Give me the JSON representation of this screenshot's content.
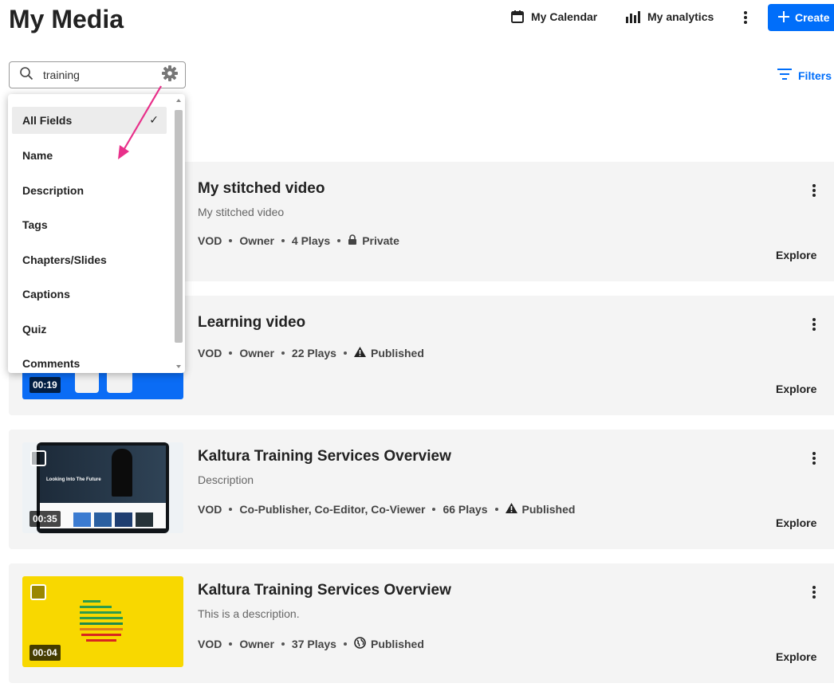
{
  "page": {
    "title": "My Media"
  },
  "header": {
    "calendar_label": "My Calendar",
    "analytics_label": "My analytics",
    "create_label": "Create"
  },
  "search": {
    "value": "training",
    "filters_label": "Filters"
  },
  "search_fields_menu": {
    "items": [
      "All Fields",
      "Name",
      "Description",
      "Tags",
      "Chapters/Slides",
      "Captions",
      "Quiz",
      "Comments"
    ],
    "selected": "All Fields",
    "check_glyph": "✓"
  },
  "media": [
    {
      "title": "My stitched video",
      "description": "My stitched video",
      "type": "VOD",
      "role": "Owner",
      "plays": "4 Plays",
      "status": "Private",
      "status_icon": "lock-icon",
      "duration": "",
      "explore": "Explore"
    },
    {
      "title": "Learning video",
      "description": "",
      "type": "VOD",
      "role": "Owner",
      "plays": "22 Plays",
      "status": "Published",
      "status_icon": "warning-icon",
      "duration": "00:19",
      "explore": "Explore"
    },
    {
      "title": "Kaltura Training Services Overview",
      "description": "Description",
      "type": "VOD",
      "role": "Co-Publisher, Co-Editor, Co-Viewer",
      "plays": "66 Plays",
      "status": "Published",
      "status_icon": "warning-icon",
      "duration": "00:35",
      "explore": "Explore"
    },
    {
      "title": "Kaltura Training Services Overview",
      "description": "This is a description.",
      "type": "VOD",
      "role": "Owner",
      "plays": "37 Plays",
      "status": "Published",
      "status_icon": "globe-icon",
      "duration": "00:04",
      "explore": "Explore"
    }
  ],
  "thumbnail_text": {
    "video_3_heading": "Looking Into The Future"
  },
  "colors": {
    "accent": "#006efa",
    "annotation_arrow": "#e8308a",
    "thumb_yellow": "#f8d800",
    "thumb_blue": "#0a6cf5"
  }
}
